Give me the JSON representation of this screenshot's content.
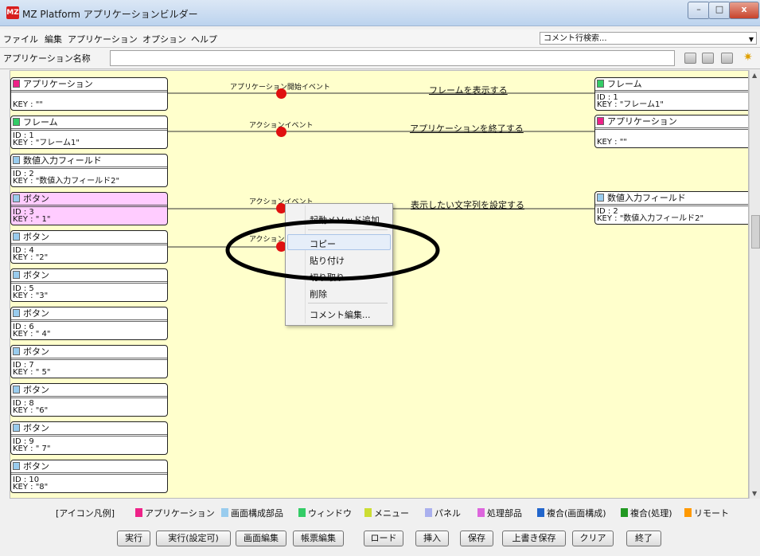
{
  "window": {
    "title": "MZ Platform アプリケーションビルダー",
    "app_icon_text": "MZ",
    "minimize": "–",
    "maximize": "□",
    "close": "x"
  },
  "menu": {
    "file": "ファイル",
    "edit": "編集",
    "app": "アプリケーション",
    "options": "オプション",
    "help": "ヘルプ"
  },
  "search": {
    "value": "コメント行検索...",
    "arrow": "▼"
  },
  "app_name": {
    "label": "アプリケーション名称",
    "value": ""
  },
  "star_icon": "✷",
  "components": [
    {
      "title": "アプリケーション",
      "line1": "",
      "line2": "KEY : \"\"",
      "color": "#ee2288"
    },
    {
      "title": "フレーム",
      "line1": "ID : 1",
      "line2": "KEY : \"フレーム1\"",
      "color": "#33cc66"
    },
    {
      "title": "数値入力フィールド",
      "line1": "ID : 2",
      "line2": "KEY : \"数値入力フィールド2\"",
      "color": "#99ccee"
    },
    {
      "title": "ボタン",
      "line1": "ID : 3",
      "line2": "KEY : \" 1\"",
      "color": "#99ccee"
    },
    {
      "title": "ボタン",
      "line1": "ID : 4",
      "line2": "KEY : \"2\"",
      "color": "#99ccee"
    },
    {
      "title": "ボタン",
      "line1": "ID : 5",
      "line2": "KEY : \"3\"",
      "color": "#99ccee"
    },
    {
      "title": "ボタン",
      "line1": "ID : 6",
      "line2": "KEY : \" 4\"",
      "color": "#99ccee"
    },
    {
      "title": "ボタン",
      "line1": "ID : 7",
      "line2": "KEY : \" 5\"",
      "color": "#99ccee"
    },
    {
      "title": "ボタン",
      "line1": "ID : 8",
      "line2": "KEY : \"6\"",
      "color": "#99ccee"
    },
    {
      "title": "ボタン",
      "line1": "ID : 9",
      "line2": "KEY : \" 7\"",
      "color": "#99ccee"
    },
    {
      "title": "ボタン",
      "line1": "ID : 10",
      "line2": "KEY : \"8\"",
      "color": "#99ccee"
    },
    {
      "title": "ボタン",
      "line1": "",
      "line2": "",
      "color": "#99ccee"
    }
  ],
  "targets": [
    {
      "title": "フレーム",
      "line1": "ID : 1",
      "line2": "KEY : \"フレーム1\"",
      "color": "#33cc66"
    },
    {
      "title": "アプリケーション",
      "line1": "",
      "line2": "KEY : \"\"",
      "color": "#ee2288"
    },
    {
      "title": "数値入力フィールド",
      "line1": "ID : 2",
      "line2": "KEY : \"数値入力フィールド2\"",
      "color": "#99ccee"
    }
  ],
  "events": {
    "e1": "アプリケーション開始イベント",
    "e2": "アクションイベント",
    "e3": "アクションイベント",
    "e4": "アクション"
  },
  "methods": {
    "m1": "フレームを表示する",
    "m2": "アプリケーションを終了する",
    "m3": "表示したい文字列を設定する"
  },
  "context_menu": {
    "add_startup": "起動メソッド追加",
    "copy": "コピー",
    "paste": "貼り付け",
    "cut": "切り取り",
    "delete": "削除",
    "edit_comment": "コメント編集..."
  },
  "legend": {
    "title": "[アイコン凡例]",
    "items": [
      {
        "label": "アプリケーション",
        "color": "#ee2288"
      },
      {
        "label": "画面構成部品",
        "color": "#99ccee"
      },
      {
        "label": "ウィンドウ",
        "color": "#33cc66"
      },
      {
        "label": "メニュー",
        "color": "#ccdd33"
      },
      {
        "label": "パネル",
        "color": "#aab0ee"
      },
      {
        "label": "処理部品",
        "color": "#dd66dd"
      },
      {
        "label": "複合(画面構成)",
        "color": "#2266cc"
      },
      {
        "label": "複合(処理)",
        "color": "#229922"
      },
      {
        "label": "リモート",
        "color": "#ff9900"
      }
    ]
  },
  "buttons": {
    "run": "実行",
    "run_config": "実行(設定可)",
    "screen_edit": "画面編集",
    "form_edit": "帳票編集",
    "load": "ロード",
    "insert": "挿入",
    "save": "保存",
    "overwrite": "上書き保存",
    "clear": "クリア",
    "exit": "終了"
  },
  "colors": {
    "canvas_bg": "#ffffcc",
    "selected_bg": "#ffccff",
    "dot": "#e01010",
    "annotation_ring": "#000000"
  }
}
